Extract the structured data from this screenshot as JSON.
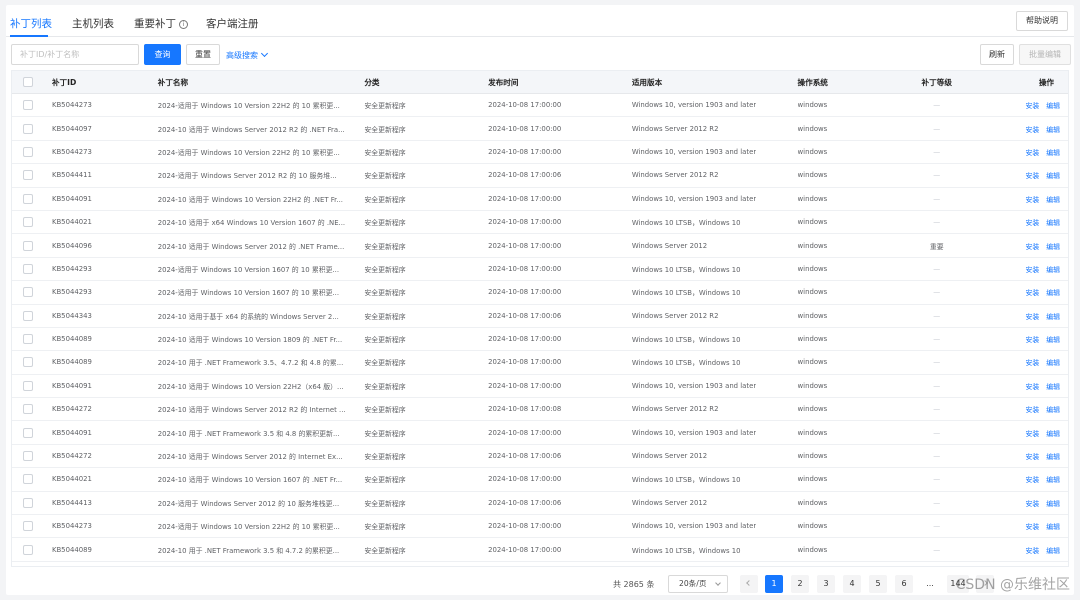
{
  "tabs": [
    {
      "label": "补丁列表",
      "active": true
    },
    {
      "label": "主机列表"
    },
    {
      "label": "重要补丁",
      "icon": "info-icon"
    },
    {
      "label": "客户端注册"
    }
  ],
  "help_label": "帮助说明",
  "toolbar": {
    "search_placeholder": "补丁ID/补丁名称",
    "query_label": "查询",
    "reset_label": "重置",
    "advanced_label": "高级搜索",
    "refresh_label": "刷新",
    "batch_edit_label": "批量编辑"
  },
  "table": {
    "columns": [
      "补丁ID",
      "补丁名称",
      "分类",
      "发布时间",
      "适用版本",
      "操作系统",
      "补丁等级",
      "操作"
    ],
    "action_install": "安装",
    "action_edit": "编辑",
    "rows": [
      {
        "id": "KB5044273",
        "name": "2024-适用于 Windows 10 Version 22H2 的 10 累积更...",
        "category": "安全更新程序",
        "date": "2024-10-08 17:00:00",
        "version": "Windows 10, version 1903 and later",
        "os": "windows",
        "level": "—"
      },
      {
        "id": "KB5044097",
        "name": "2024-10 适用于 Windows Server 2012 R2 的 .NET Fra...",
        "category": "安全更新程序",
        "date": "2024-10-08 17:00:00",
        "version": "Windows Server 2012 R2",
        "os": "windows",
        "level": "—"
      },
      {
        "id": "KB5044273",
        "name": "2024-适用于 Windows 10 Version 22H2 的 10 累积更...",
        "category": "安全更新程序",
        "date": "2024-10-08 17:00:00",
        "version": "Windows 10, version 1903 and later",
        "os": "windows",
        "level": "—"
      },
      {
        "id": "KB5044411",
        "name": "2024-适用于 Windows Server 2012 R2 的 10 服务堆...",
        "category": "安全更新程序",
        "date": "2024-10-08 17:00:06",
        "version": "Windows Server 2012 R2",
        "os": "windows",
        "level": "—"
      },
      {
        "id": "KB5044091",
        "name": "2024-10 适用于 Windows 10 Version 22H2 的 .NET Fr...",
        "category": "安全更新程序",
        "date": "2024-10-08 17:00:00",
        "version": "Windows 10, version 1903 and later",
        "os": "windows",
        "level": "—"
      },
      {
        "id": "KB5044021",
        "name": "2024-10 适用于 x64 Windows 10 Version 1607 的 .NE...",
        "category": "安全更新程序",
        "date": "2024-10-08 17:00:00",
        "version": "Windows 10 LTSB，Windows 10",
        "os": "windows",
        "level": "—"
      },
      {
        "id": "KB5044096",
        "name": "2024-10 适用于 Windows Server 2012 的 .NET Frame...",
        "category": "安全更新程序",
        "date": "2024-10-08 17:00:00",
        "version": "Windows Server 2012",
        "os": "windows",
        "level": "重要"
      },
      {
        "id": "KB5044293",
        "name": "2024-适用于 Windows 10 Version 1607 的 10 累积更...",
        "category": "安全更新程序",
        "date": "2024-10-08 17:00:00",
        "version": "Windows 10 LTSB，Windows 10",
        "os": "windows",
        "level": "—"
      },
      {
        "id": "KB5044293",
        "name": "2024-适用于 Windows 10 Version 1607 的 10 累积更...",
        "category": "安全更新程序",
        "date": "2024-10-08 17:00:00",
        "version": "Windows 10 LTSB，Windows 10",
        "os": "windows",
        "level": "—"
      },
      {
        "id": "KB5044343",
        "name": "2024-10 适用于基于 x64 的系统的 Windows Server 2...",
        "category": "安全更新程序",
        "date": "2024-10-08 17:00:06",
        "version": "Windows Server 2012 R2",
        "os": "windows",
        "level": "—"
      },
      {
        "id": "KB5044089",
        "name": "2024-10 适用于 Windows 10 Version 1809 的 .NET Fr...",
        "category": "安全更新程序",
        "date": "2024-10-08 17:00:00",
        "version": "Windows 10 LTSB，Windows 10",
        "os": "windows",
        "level": "—"
      },
      {
        "id": "KB5044089",
        "name": "2024-10 用于 .NET Framework 3.5、4.7.2 和 4.8 的累...",
        "category": "安全更新程序",
        "date": "2024-10-08 17:00:00",
        "version": "Windows 10 LTSB，Windows 10",
        "os": "windows",
        "level": "—"
      },
      {
        "id": "KB5044091",
        "name": "2024-10 适用于 Windows 10 Version 22H2（x64 版）...",
        "category": "安全更新程序",
        "date": "2024-10-08 17:00:00",
        "version": "Windows 10, version 1903 and later",
        "os": "windows",
        "level": "—"
      },
      {
        "id": "KB5044272",
        "name": "2024-10 适用于 Windows Server 2012 R2 的 Internet ...",
        "category": "安全更新程序",
        "date": "2024-10-08 17:00:08",
        "version": "Windows Server 2012 R2",
        "os": "windows",
        "level": "—"
      },
      {
        "id": "KB5044091",
        "name": "2024-10 用于 .NET Framework 3.5 和 4.8 的累积更新...",
        "category": "安全更新程序",
        "date": "2024-10-08 17:00:00",
        "version": "Windows 10, version 1903 and later",
        "os": "windows",
        "level": "—"
      },
      {
        "id": "KB5044272",
        "name": "2024-10 适用于 Windows Server 2012 的 Internet Ex...",
        "category": "安全更新程序",
        "date": "2024-10-08 17:00:06",
        "version": "Windows Server 2012",
        "os": "windows",
        "level": "—"
      },
      {
        "id": "KB5044021",
        "name": "2024-10 适用于 Windows 10 Version 1607 的 .NET Fr...",
        "category": "安全更新程序",
        "date": "2024-10-08 17:00:00",
        "version": "Windows 10 LTSB，Windows 10",
        "os": "windows",
        "level": "—"
      },
      {
        "id": "KB5044413",
        "name": "2024-适用于 Windows Server 2012 的 10 服务堆栈更...",
        "category": "安全更新程序",
        "date": "2024-10-08 17:00:06",
        "version": "Windows Server 2012",
        "os": "windows",
        "level": "—"
      },
      {
        "id": "KB5044273",
        "name": "2024-适用于 Windows 10 Version 22H2 的 10 累积更...",
        "category": "安全更新程序",
        "date": "2024-10-08 17:00:00",
        "version": "Windows 10, version 1903 and later",
        "os": "windows",
        "level": "—"
      },
      {
        "id": "KB5044089",
        "name": "2024-10 用于 .NET Framework 3.5 和 4.7.2 的累积更...",
        "category": "安全更新程序",
        "date": "2024-10-08 17:00:00",
        "version": "Windows 10 LTSB，Windows 10",
        "os": "windows",
        "level": "—"
      }
    ]
  },
  "pagination": {
    "total_text": "共 2865 条",
    "page_size": "20条/页",
    "pages": [
      "1",
      "2",
      "3",
      "4",
      "5",
      "6"
    ],
    "active_page": "1",
    "ellipsis": "...",
    "last_page": "144"
  },
  "watermark": "CSDN @乐维社区",
  "colors": {
    "accent": "#1677ff"
  }
}
